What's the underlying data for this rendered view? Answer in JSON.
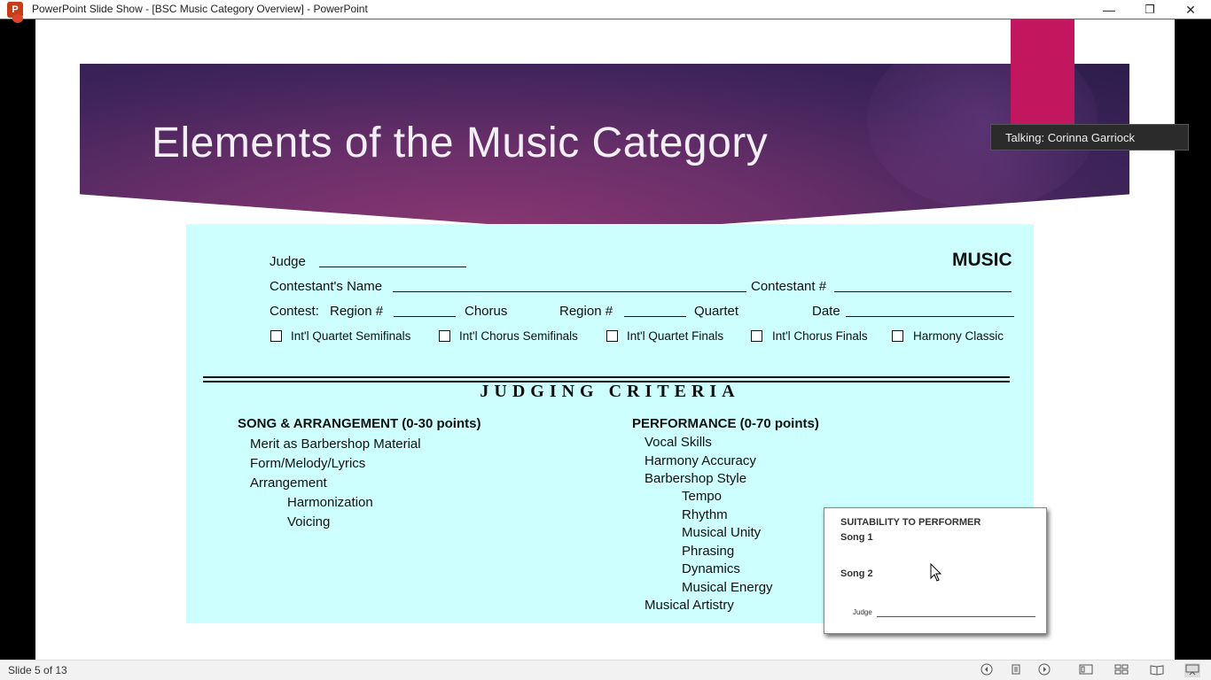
{
  "window": {
    "title": "PowerPoint Slide Show - [BSC Music Category Overview] - PowerPoint",
    "app_icon_letter": "P",
    "minimize": "—",
    "restore": "❐",
    "close": "✕"
  },
  "slide": {
    "title": "Elements of the Music Category"
  },
  "sheet": {
    "judge_label": "Judge",
    "music_label": "MUSIC",
    "contestant_name_label": "Contestant's Name",
    "contestant_number_label": "Contestant #",
    "contest_label": "Contest:",
    "region_label_1": "Region #",
    "chorus_label": "Chorus",
    "region_label_2": "Region #",
    "quartet_label": "Quartet",
    "date_label": "Date",
    "checkboxes": [
      "Int'l Quartet Semifinals",
      "Int'l Chorus Semifinals",
      "Int'l Quartet Finals",
      "Int'l Chorus Finals",
      "Harmony Classic"
    ],
    "judging_criteria": "JUDGING CRITERIA",
    "song": {
      "heading": "SONG & ARRANGEMENT (0-30 points)",
      "items": [
        "Merit as Barbershop Material",
        "Form/Melody/Lyrics",
        "Arrangement"
      ],
      "sub_items": [
        "Harmonization",
        "Voicing"
      ]
    },
    "performance": {
      "heading": "PERFORMANCE (0-70 points)",
      "items": [
        "Vocal Skills",
        "Harmony Accuracy",
        "Barbershop Style"
      ],
      "sub_items": [
        "Tempo",
        "Rhythm",
        "Musical Unity",
        "Phrasing",
        "Dynamics",
        "Musical Energy"
      ],
      "last_item": "Musical Artistry"
    }
  },
  "card": {
    "heading": "SUITABILITY TO PERFORMER",
    "song1": "Song 1",
    "song2": "Song 2",
    "judge": "Judge"
  },
  "tooltip": {
    "text": "Talking: Corinna Garriock"
  },
  "statusbar": {
    "slide_counter": "Slide 5 of 13",
    "icons": [
      "previous-icon",
      "notes-icon",
      "next-icon",
      "normal-view-icon",
      "slide-sorter-icon",
      "reading-view-icon",
      "slideshow-icon"
    ]
  },
  "colors": {
    "sheet_bg": "#ccfffe",
    "banner_dark": "#2d1d4b",
    "banner_magenta": "#8a3771",
    "accent_pink": "#c2175f"
  }
}
